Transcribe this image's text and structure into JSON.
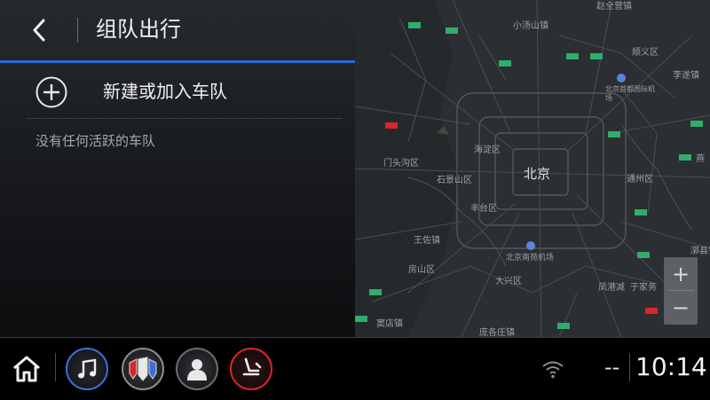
{
  "header": {
    "title": "组队出行"
  },
  "actions": {
    "new_team_label": "新建或加入车队"
  },
  "status": {
    "empty_message": "没有任何活跃的车队"
  },
  "map": {
    "labels": {
      "city": "北京",
      "zhaoquanying": "赵全营镇",
      "xiaotangshan": "小汤山镇",
      "shunyi": "顺义区",
      "lisui": "李遂镇",
      "airport": "北京首都国际机场",
      "haidian": "海淀区",
      "mentougou": "门头沟区",
      "shijingshan": "石景山区",
      "tongzhou": "通州区",
      "fengtai": "丰台区",
      "wangzuo": "王佐镇",
      "daxing_airport": "北京南苑机场",
      "fangshan": "房山区",
      "daxing": "大兴区",
      "fenggezhuang": "凤港减",
      "yujiawu": "于家务",
      "douge": "窦店镇",
      "pangezhuang": "庞各庄镇",
      "yan": "燕",
      "li": "漷县镇"
    },
    "zoom_in": "+",
    "zoom_out": "−"
  },
  "bottom_bar": {
    "dashes": "--",
    "time": "10:14"
  },
  "icons": {
    "back": "chevron-left-icon",
    "add": "plus-circle-icon",
    "home": "home-icon",
    "music": "music-note-icon",
    "brand": "buick-logo-icon",
    "profile": "person-icon",
    "seat": "seat-icon",
    "wifi": "wifi-icon"
  },
  "colors": {
    "accent_blue": "#2f66d6",
    "seat_red": "#d8262e",
    "music_ring": "#3d6fd8"
  }
}
